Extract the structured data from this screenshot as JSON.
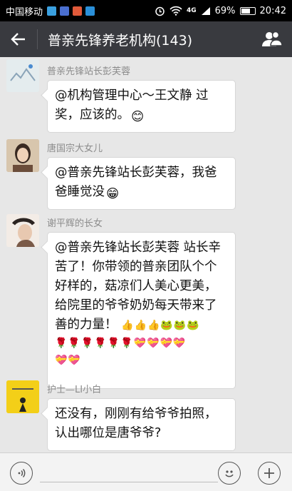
{
  "status_bar": {
    "carrier": "中国移动",
    "network": "4G",
    "battery": "69%",
    "time": "20:42"
  },
  "header": {
    "back_icon": "back-arrow-icon",
    "title": "普亲先锋养老机构(143)",
    "group_icon": "group-members-icon"
  },
  "messages": [
    {
      "sender": "普亲先锋站长彭芙蓉",
      "lines": [
        "@机构管理中心～王文静 过",
        "奖，应该的。"
      ],
      "emoji": "😊"
    },
    {
      "sender": "唐国宗大女儿",
      "lines": [
        "@普亲先锋站长彭芙蓉，我爸",
        "爸睡觉没"
      ],
      "emoji": "😁"
    },
    {
      "sender": "谢平辉的长女",
      "lines": [
        "@普亲先锋站长彭芙蓉 站长辛",
        "苦了！你带领的普亲团队个个",
        "好样的，菇凉们人美心更美，",
        "给院里的爷爷奶奶每天带来了",
        "善的力量！"
      ],
      "emoji_row_1": "👍👍👍🐸🐸🐸",
      "emoji_row_2": "🌹🌹🌹🌹🌹🌹💝💝💝💝",
      "emoji_row_3": "💝💝"
    },
    {
      "sender": "护士—LI小白",
      "lines": [
        "还没有，刚刚有给爷爷拍照，",
        "认出哪位是唐爷爷?"
      ]
    }
  ],
  "bottom_bar": {
    "voice_icon": "voice-input-icon",
    "emoji_icon": "emoji-icon",
    "plus_icon": "plus-icon"
  }
}
